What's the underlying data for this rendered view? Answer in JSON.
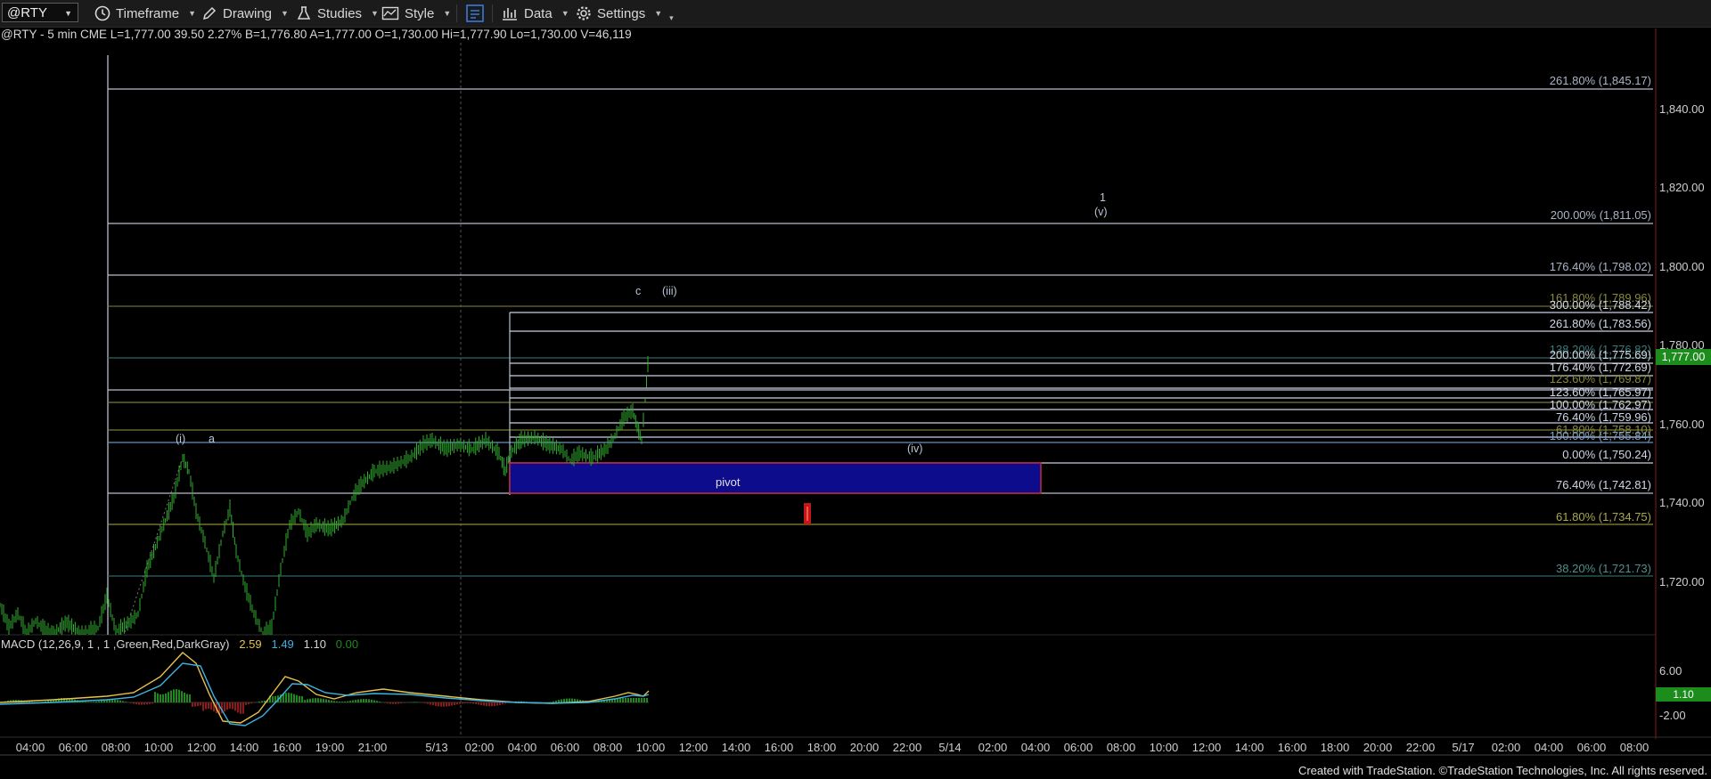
{
  "toolbar": {
    "symbol": "@RTY",
    "timeframe_label": "Timeframe",
    "drawing_label": "Drawing",
    "studies_label": "Studies",
    "style_label": "Style",
    "data_label": "Data",
    "settings_label": "Settings"
  },
  "info_line": "@RTY - 5 min  CME  L=1,777.00  39.50  2.27%  B=1,776.80  A=1,777.00  O=1,730.00  Hi=1,777.90  Lo=1,730.00  V=46,119",
  "last_price_tag": "1,777.00",
  "y_axis": [
    "1,840.00",
    "1,820.00",
    "1,800.00",
    "1,780.00",
    "1,760.00",
    "1,740.00",
    "1,720.00"
  ],
  "fib_labels": [
    {
      "text": "261.80% (1,845.17)",
      "color": "#aab4c8"
    },
    {
      "text": "200.00% (1,811.05)",
      "color": "#aab4c8"
    },
    {
      "text": "176.40% (1,798.02)",
      "color": "#aab4c8"
    },
    {
      "text": "161.80% (1,789.96)",
      "color": "#8a8a3a"
    },
    {
      "text": "300.00% (1,788.42)",
      "color": "#d0d8e8"
    },
    {
      "text": "261.80% (1,783.56)",
      "color": "#d0d8e8"
    },
    {
      "text": "138.20% (1,776.82)",
      "color": "#3a7a78"
    },
    {
      "text": "200.00% (1,775.69)",
      "color": "#d0d8e8"
    },
    {
      "text": "176.40% (1,772.69)",
      "color": "#d0d8e8"
    },
    {
      "text": "123.60% (1,769.87)",
      "color": "#8a8a3a"
    },
    {
      "text": "123.60% (1,765.97)",
      "color": "#d0d8e8"
    },
    {
      "text": "100.00% (1,762.97)",
      "color": "#d0d8e8"
    },
    {
      "text": "76.40% (1,759.96)",
      "color": "#d0d8e8"
    },
    {
      "text": "61.80% (1,758.10)",
      "color": "#8a8a3a"
    },
    {
      "text": "100.00% (1,755.84)",
      "color": "#7aa0c8"
    },
    {
      "text": "0.00% (1,750.24)",
      "color": "#d0d8e8"
    },
    {
      "text": "76.40% (1,742.81)",
      "color": "#d0d8e8"
    },
    {
      "text": "61.80% (1,734.75)",
      "color": "#a8a850"
    },
    {
      "text": "38.20% (1,721.73)",
      "color": "#4f8f8a"
    }
  ],
  "wave_labels": [
    "(i)",
    "a",
    "c",
    "(iii)",
    "(iv)",
    "1",
    "(v)"
  ],
  "pivot_label": "pivot",
  "macd": {
    "header_name": "MACD (12,26,9, 1 , 1 ,Green,Red,DarkGray)",
    "v1": "2.59",
    "v2": "1.49",
    "v3": "1.10",
    "v4": "0.00",
    "axis": [
      "6.00",
      "-2.00"
    ],
    "tag": "1.10"
  },
  "x_axis": [
    "04:00",
    "06:00",
    "08:00",
    "10:00",
    "12:00",
    "14:00",
    "16:00",
    "19:00",
    "21:00",
    "5/13",
    "02:00",
    "04:00",
    "06:00",
    "08:00",
    "10:00",
    "12:00",
    "14:00",
    "16:00",
    "18:00",
    "20:00",
    "22:00",
    "5/14",
    "02:00",
    "04:00",
    "06:00",
    "08:00",
    "10:00",
    "12:00",
    "14:00",
    "16:00",
    "18:00",
    "20:00",
    "22:00",
    "5/17",
    "02:00",
    "04:00",
    "06:00",
    "08:00"
  ],
  "credit": "Created with TradeStation. ©TradeStation Technologies, Inc. All rights reserved.",
  "colors": {
    "background": "#000000",
    "candle": "#2fae2f",
    "pivot_fill": "#0c0c8c",
    "pivot_border": "#c02a40",
    "macd_up": "#1e8a1e",
    "macd_down": "#8e1a1a",
    "macd_line": "#e8c24a",
    "signal_line": "#3ab4e0"
  },
  "icons": [
    "timeframe-clock-icon",
    "drawing-pencil-icon",
    "studies-flask-icon",
    "style-chart-icon",
    "data-window-icon",
    "data-bars-icon",
    "settings-gear-icon"
  ]
}
